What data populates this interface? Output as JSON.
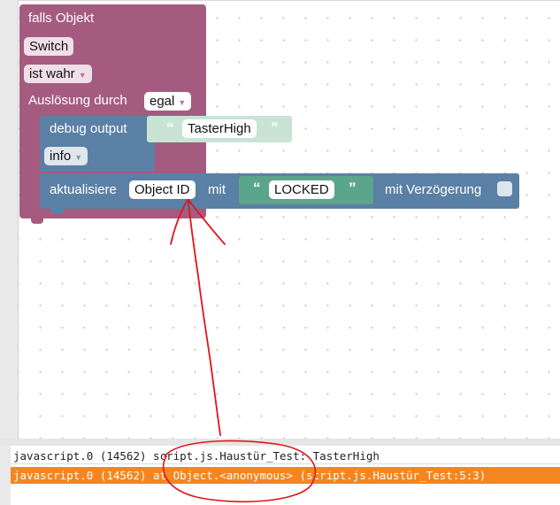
{
  "blocks": {
    "event": {
      "title": "falls Objekt",
      "object": "Switch",
      "condition": "ist wahr",
      "trigger_label": "Auslösung durch",
      "trigger_value": "egal"
    },
    "debug": {
      "label": "debug output",
      "text": "TasterHigh",
      "level": "info"
    },
    "update": {
      "label": "aktualisiere",
      "object": "Object ID",
      "with_label": "mit",
      "value": "LOCKED",
      "delay_label": "mit Verzögerung"
    }
  },
  "log": {
    "rows": [
      "javascript.0 (14562) script.js.Haustür_Test: TasterHigh",
      "javascript.0 (14562) at Object.<anonymous> (script.js.Haustür_Test:5:3)"
    ]
  },
  "colors": {
    "event_block": "#a55b80",
    "action_block": "#5b80a5",
    "text_block": "#5ba58c",
    "error_row": "#f5861f",
    "annotation": "#e0141e"
  },
  "icons": {
    "dropdown": "triangle-down-icon",
    "quote_open": "open-quote-icon",
    "quote_close": "close-quote-icon"
  }
}
